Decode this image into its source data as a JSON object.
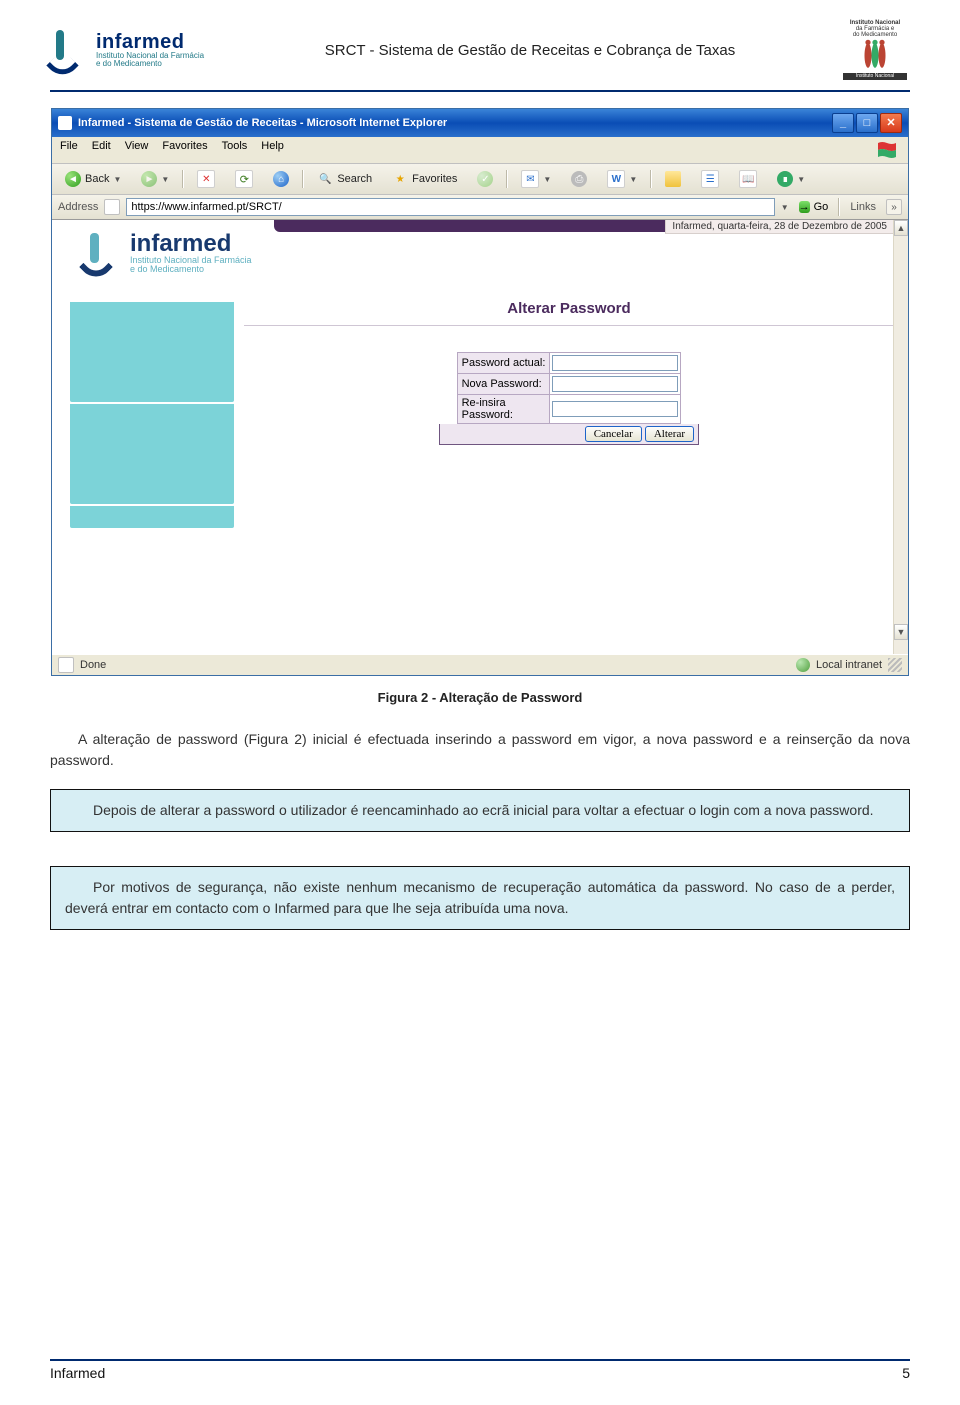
{
  "doc_header": {
    "title": "SRCT - Sistema de Gestão de Receitas e Cobrança de Taxas",
    "logo_name": "infarmed",
    "logo_sub1": "Instituto Nacional da Farmácia",
    "logo_sub2": "e do Medicamento",
    "right_label1": "Instituto Nacional",
    "right_label2": "da Farmácia e",
    "right_label3": "do Medicamento"
  },
  "browser": {
    "window_title": "Infarmed - Sistema de Gestão de Receitas - Microsoft Internet Explorer",
    "menu": {
      "file": "File",
      "edit": "Edit",
      "view": "View",
      "favorites": "Favorites",
      "tools": "Tools",
      "help": "Help"
    },
    "toolbar": {
      "back": "Back",
      "search": "Search",
      "favorites": "Favorites"
    },
    "address_label": "Address",
    "url": "https://www.infarmed.pt/SRCT/",
    "go": "Go",
    "links": "Links",
    "status_left": "Done",
    "status_right": "Local intranet"
  },
  "app": {
    "top_status": "Infarmed, quarta-feira, 28 de Dezembro de 2005",
    "logo_name": "infarmed",
    "logo_sub1": "Instituto Nacional da Farmácia",
    "logo_sub2": "e do Medicamento",
    "heading": "Alterar Password",
    "labels": {
      "current": "Password actual:",
      "new": "Nova Password:",
      "confirm1": "Re-insira",
      "confirm2": "Password:"
    },
    "buttons": {
      "cancel": "Cancelar",
      "submit": "Alterar"
    }
  },
  "body": {
    "figure_caption": "Figura 2 - Alteração de Password",
    "para1": "A alteração de password (Figura 2) inicial é efectuada inserindo a password em vigor, a nova password e a reinserção da nova password.",
    "box1": "Depois de alterar a password o utilizador é reencaminhado ao ecrã inicial para voltar a efectuar o login com a nova password.",
    "box2": "Por motivos de segurança, não existe nenhum mecanismo de recuperação automática da password. No caso de a perder, deverá entrar em contacto com o Infarmed para que lhe seja atribuída uma nova."
  },
  "footer": {
    "left": "Infarmed",
    "right": "5"
  }
}
